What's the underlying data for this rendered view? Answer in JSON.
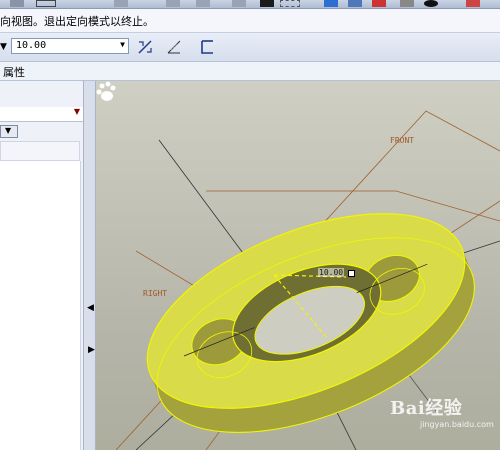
{
  "message_bar": {
    "text": "向视图。退出定向模式以终止。"
  },
  "dashboard": {
    "value": "10.00"
  },
  "tabs": {
    "properties": "属性"
  },
  "viewport": {
    "datum_front": "FRONT",
    "datum_right": "RIGHT",
    "dimension_value": "10.00",
    "watermark_main": "Bai经验",
    "watermark_url": "jingyan.baidu.com"
  }
}
